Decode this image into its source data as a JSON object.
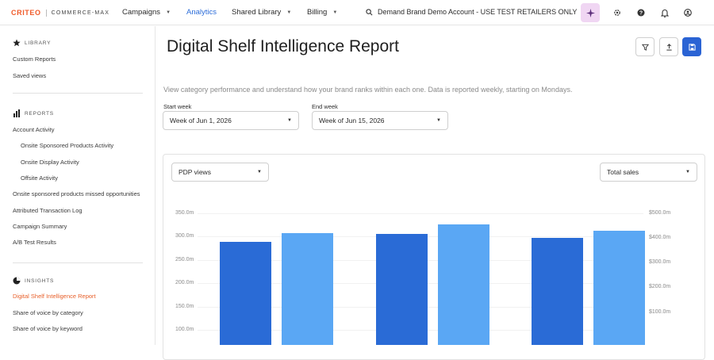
{
  "topbar": {
    "brand": "CRITEO",
    "product": "COMMERCE-MAX",
    "nav": [
      {
        "label": "Campaigns",
        "dropdown": true
      },
      {
        "label": "Analytics",
        "dropdown": false,
        "active": true
      },
      {
        "label": "Shared Library",
        "dropdown": true
      },
      {
        "label": "Billing",
        "dropdown": true
      }
    ],
    "account": "Demand Brand Demo Account - USE TEST RETAILERS ONLY",
    "icons": [
      "search-icon",
      "sparkle-icon",
      "gear-icon",
      "help-icon",
      "bell-icon",
      "user-icon"
    ]
  },
  "sidebar": {
    "library": {
      "heading": "LIBRARY",
      "items": [
        "Custom Reports",
        "Saved views"
      ]
    },
    "reports": {
      "heading": "REPORTS",
      "items": [
        {
          "label": "Account Activity",
          "indent": false
        },
        {
          "label": "Onsite Sponsored Products Activity",
          "indent": true
        },
        {
          "label": "Onsite Display Activity",
          "indent": true
        },
        {
          "label": "Offsite Activity",
          "indent": true
        },
        {
          "label": "Onsite sponsored products missed opportunities",
          "indent": false
        },
        {
          "label": "Attributed Transaction Log",
          "indent": false
        },
        {
          "label": "Campaign Summary",
          "indent": false
        },
        {
          "label": "A/B Test Results",
          "indent": false
        }
      ]
    },
    "insights": {
      "heading": "INSIGHTS",
      "items": [
        {
          "label": "Digital Shelf Intelligence Report",
          "active": true
        },
        {
          "label": "Share of voice by category",
          "active": false
        },
        {
          "label": "Share of voice by keyword",
          "active": false
        }
      ]
    }
  },
  "main": {
    "title": "Digital Shelf Intelligence Report",
    "description": "View category performance and understand how your brand ranks within each one. Data is reported weekly, starting on Mondays.",
    "start_week": {
      "label": "Start week",
      "value": "Week of Jun 1, 2026"
    },
    "end_week": {
      "label": "End week",
      "value": "Week of Jun 15, 2026"
    },
    "header_buttons": [
      "filter-icon",
      "export-icon",
      "save-icon"
    ]
  },
  "chart": {
    "left_metric": "PDP views",
    "right_metric": "Total sales",
    "colors": {
      "primary": "#2a6bd6",
      "secondary": "#5aa7f4"
    },
    "left_ticks": [
      "350.0m",
      "300.0m",
      "250.0m",
      "200.0m",
      "150.0m",
      "100.0m"
    ],
    "right_ticks": [
      "$500.0m",
      "$400.0m",
      "$300.0m",
      "$200.0m",
      "$100.0m"
    ]
  },
  "chart_data": {
    "type": "bar",
    "series": [
      {
        "values": [
          289,
          305,
          297
        ]
      },
      {
        "values": [
          308,
          327,
          313
        ]
      }
    ],
    "ylim": [
      100,
      350
    ],
    "y2lim": [
      100,
      500
    ],
    "ylabel": "",
    "xlabel": ""
  }
}
